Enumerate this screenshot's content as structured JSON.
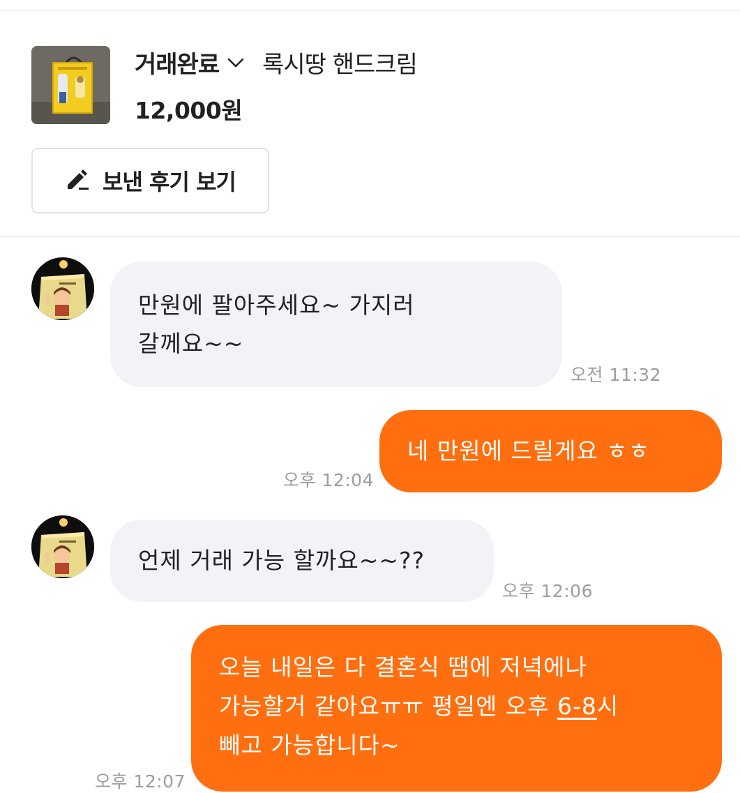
{
  "header": {
    "status_label": "거래완료",
    "product_title": "록시땅 핸드크림",
    "price": "12,000원",
    "review_button_label": "보낸 후기 보기"
  },
  "colors": {
    "accent": "#ff6f0f",
    "incoming_bubble": "#f2f3f6",
    "timestamp": "#9a9ca3"
  },
  "icons": {
    "status_dropdown": "chevron-down-icon",
    "review_button": "pencil-icon",
    "avatar": "avatar-photo"
  },
  "messages": [
    {
      "direction": "in",
      "lines": [
        "만원에 팔아주세요~ 가지러",
        "갈께요~~"
      ],
      "time": "오전 11:32"
    },
    {
      "direction": "out",
      "lines": [
        "네 만원에 드릴게요 ㅎㅎ"
      ],
      "time": "오후 12:04"
    },
    {
      "direction": "in",
      "lines": [
        "언제 거래 가능 할까요~~??"
      ],
      "time": "오후 12:06"
    },
    {
      "direction": "out",
      "lines": [
        "오늘 내일은 다 결혼식 땜에 저녁에나",
        "가능할거 같아요ㅠㅠ 평일엔 오후 ",
        "6-8",
        "시",
        "빼고 가능합니다~"
      ],
      "time": "오후 12:07"
    }
  ]
}
